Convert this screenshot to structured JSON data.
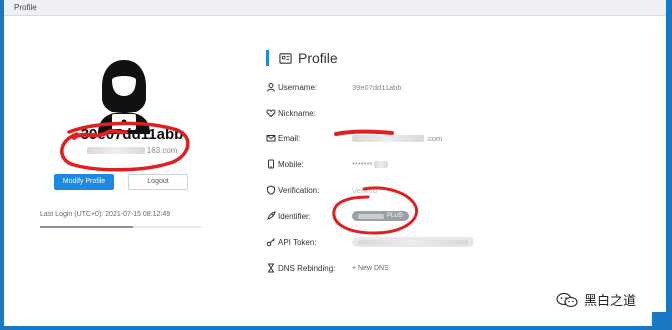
{
  "window": {
    "title": "Profile"
  },
  "profile_card": {
    "username": "39e07dd11abb",
    "email_visible_suffix": "163.com",
    "modify_button": "Modify Profile",
    "logout_button": "Logout",
    "last_login": "Last Login (UTC+0): 2021-07-15 08:12:49",
    "progress_fraction": 0.58
  },
  "details": {
    "section_title": "Profile",
    "rows": [
      {
        "label": "Username:",
        "value": "39e07dd11abb",
        "icon": "user-icon"
      },
      {
        "label": "Nickname:",
        "value": "",
        "icon": "heart-icon"
      },
      {
        "label": "Email:",
        "value": ".com",
        "icon": "mail-icon"
      },
      {
        "label": "Mobile:",
        "value": "*******",
        "icon": "phone-icon"
      },
      {
        "label": "Verification:",
        "value": "Verified",
        "icon": "shield-icon"
      },
      {
        "label": "Identifier:",
        "value": "PLUS",
        "icon": "rocket-icon"
      },
      {
        "label": "API Token:",
        "value": "",
        "icon": "key-icon"
      },
      {
        "label": "DNS Rebinding:",
        "value": "+ New DNS",
        "icon": "hourglass-icon"
      }
    ]
  },
  "watermark": {
    "text": "黑白之道"
  },
  "colors": {
    "accent": "#1e88e5",
    "frame": "#1a78c2",
    "annotation": "#e02020"
  }
}
